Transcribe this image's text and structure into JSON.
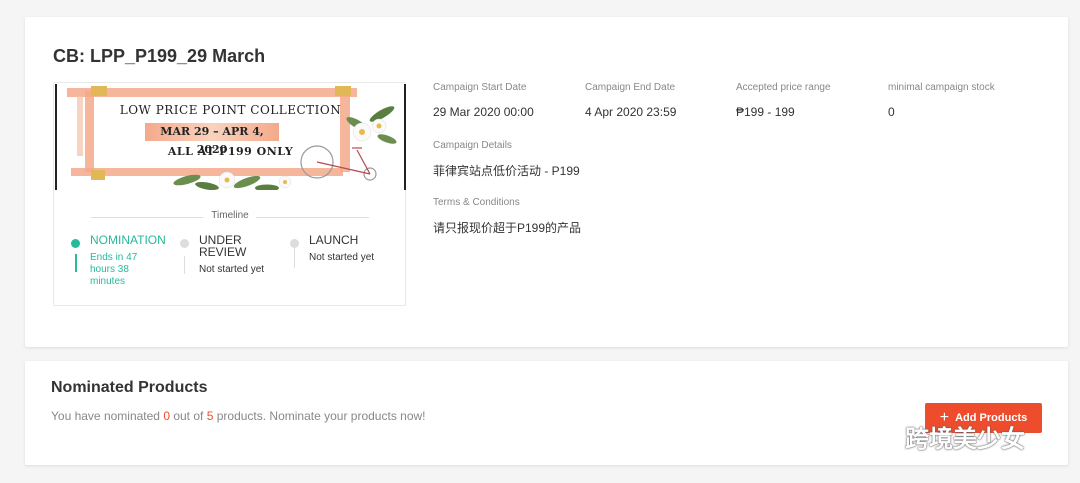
{
  "campaign": {
    "title": "CB: LPP_P199_29 March",
    "banner": {
      "line1": "LOW PRICE POINT COLLECTION",
      "line2": "MAR 29 – APR 4, 2020",
      "line3": "ALL AT P199 ONLY",
      "colors": {
        "accent": "#f4a98a",
        "frame": "#222222"
      }
    },
    "timeline": {
      "label": "Timeline",
      "steps": [
        {
          "title": "NOMINATION",
          "sub": "Ends in 47 hours 38 minutes",
          "active": true
        },
        {
          "title": "UNDER REVIEW",
          "sub": "Not started yet",
          "active": false
        },
        {
          "title": "LAUNCH",
          "sub": "Not started yet",
          "active": false
        }
      ]
    },
    "info": {
      "start_label": "Campaign Start Date",
      "start_value": "29 Mar 2020 00:00",
      "end_label": "Campaign End Date",
      "end_value": "4 Apr 2020 23:59",
      "price_label": "Accepted price range",
      "price_value": "₱199 - 199",
      "stock_label": "minimal campaign stock",
      "stock_value": "0",
      "details_label": "Campaign Details",
      "details_value": "菲律宾站点低价活动 - P199",
      "terms_label": "Terms & Conditions",
      "terms_value": "请只报现价超于P199的产品"
    }
  },
  "nominated": {
    "title": "Nominated Products",
    "desc_prefix": "You have nominated ",
    "nominated_count": "0",
    "desc_mid": " out of ",
    "max_count": "5",
    "desc_suffix": " products.  Nominate your products now!",
    "add_button_icon": "plus-icon",
    "add_button_label": "Add Products"
  },
  "watermark": {
    "icon": "wechat-icon",
    "text": "跨境美少女"
  },
  "colors": {
    "brand": "#ee4d2d",
    "active_step": "#26b99a",
    "muted_text": "#888888"
  }
}
